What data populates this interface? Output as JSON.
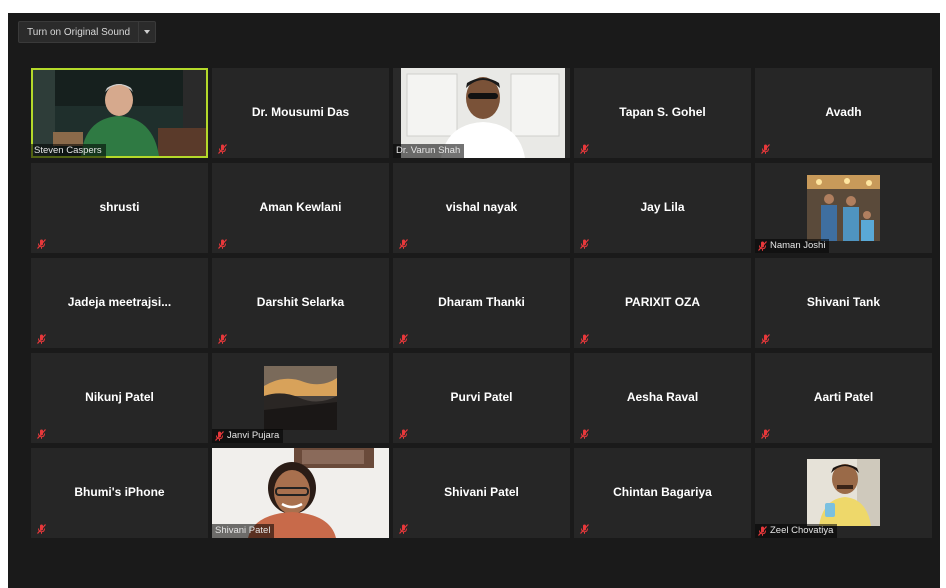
{
  "toolbar": {
    "sound_label": "Turn on Original Sound",
    "dropdown_icon": "chevron-down-icon"
  },
  "colors": {
    "window_bg": "#1a1a1a",
    "tile_bg": "#262626",
    "active_speaker_outline": "#b4d92a",
    "muted_icon": "#e8383b"
  },
  "participants": [
    {
      "name": "Steven Caspers",
      "muted": false,
      "video": "video-on",
      "active": true
    },
    {
      "name": "Dr. Mousumi Das",
      "muted": true,
      "video": "off"
    },
    {
      "name": "Dr. Varun Shah",
      "muted": false,
      "video": "video-on"
    },
    {
      "name": "Tapan S. Gohel",
      "muted": true,
      "video": "off"
    },
    {
      "name": "Avadh",
      "muted": true,
      "video": "off"
    },
    {
      "name": "shrusti",
      "muted": true,
      "video": "off"
    },
    {
      "name": "Aman Kewlani",
      "muted": true,
      "video": "off"
    },
    {
      "name": "vishal nayak",
      "muted": true,
      "video": "off"
    },
    {
      "name": "Jay Lila",
      "muted": true,
      "video": "off"
    },
    {
      "name": "Naman Joshi",
      "muted": true,
      "video": "profile-photo"
    },
    {
      "name": "Jadeja  meetrajsi...",
      "muted": true,
      "video": "off"
    },
    {
      "name": "Darshit Selarka",
      "muted": true,
      "video": "off"
    },
    {
      "name": "Dharam Thanki",
      "muted": true,
      "video": "off"
    },
    {
      "name": "PARIXIT OZA",
      "muted": true,
      "video": "off"
    },
    {
      "name": "Shivani Tank",
      "muted": true,
      "video": "off"
    },
    {
      "name": "Nikunj Patel",
      "muted": true,
      "video": "off"
    },
    {
      "name": "Janvi Pujara",
      "muted": true,
      "video": "profile-photo"
    },
    {
      "name": "Purvi Patel",
      "muted": true,
      "video": "off"
    },
    {
      "name": "Aesha Raval",
      "muted": true,
      "video": "off"
    },
    {
      "name": "Aarti Patel",
      "muted": true,
      "video": "off"
    },
    {
      "name": "Bhumi's iPhone",
      "muted": true,
      "video": "off"
    },
    {
      "name": "Shivani Patel",
      "muted": false,
      "video": "video-on"
    },
    {
      "name": "Shivani Patel",
      "muted": true,
      "video": "off"
    },
    {
      "name": "Chintan Bagariya",
      "muted": true,
      "video": "off"
    },
    {
      "name": "Zeel Chovatiya",
      "muted": true,
      "video": "profile-photo"
    }
  ]
}
